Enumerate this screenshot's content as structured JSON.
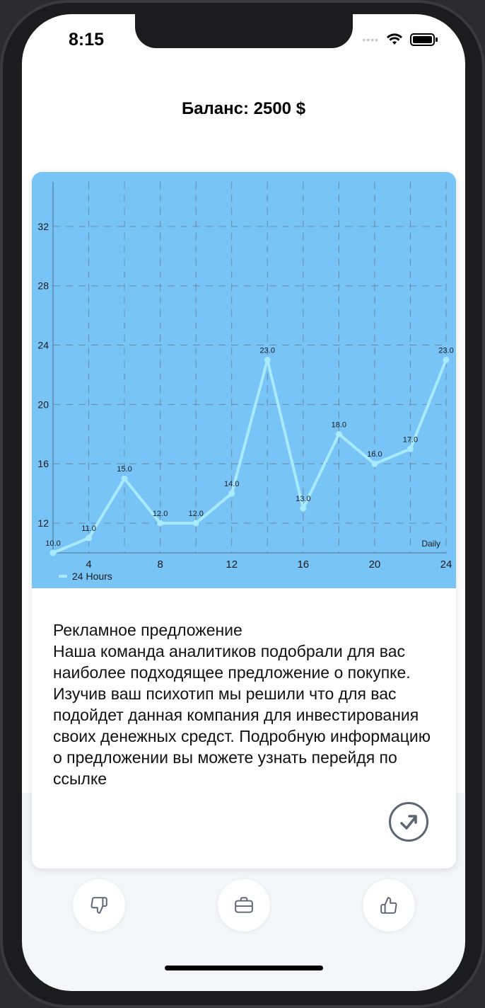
{
  "status_bar": {
    "time": "8:15"
  },
  "header": {
    "balance": "Баланс: 2500 $"
  },
  "chart_data": {
    "type": "line",
    "x": [
      2,
      4,
      6,
      8,
      10,
      12,
      14,
      16,
      18,
      20,
      22,
      24
    ],
    "series": [
      {
        "name": "24 Hours",
        "values": [
          10.0,
          11.0,
          15.0,
          12.0,
          12.0,
          14.0,
          23.0,
          13.0,
          18.0,
          16.0,
          17.0,
          23.0
        ]
      }
    ],
    "point_labels": [
      "10.0",
      "11.0",
      "15.0",
      "12.0",
      "12.0",
      "14.0",
      "23.0",
      "13.0",
      "18.0",
      "16.0",
      "17.0",
      "23.0"
    ],
    "x_ticks": [
      "4",
      "8",
      "12",
      "16",
      "20",
      "24"
    ],
    "y_ticks": [
      "12",
      "16",
      "20",
      "24",
      "28",
      "32"
    ],
    "xlim": [
      2,
      24
    ],
    "ylim": [
      10,
      35
    ],
    "xlabel": "Daily",
    "ylabel": "",
    "grid": true,
    "legend": "bottom-left",
    "colors": {
      "background": "#79c4f6",
      "line": "#a8eaff",
      "grid": "#6a8aa8",
      "text": "#1a1a1a"
    }
  },
  "ad": {
    "title": "Рекламное предложение",
    "body": "Наша команда аналитиков подобрали для вас наиболее подходящее предложение о покупке. Изучив ваш психотип мы решили что для вас подойдет данная компания для инвестирования своих денежных средст. Подробную информацию о предложении вы можете узнать перейдя по ссылке"
  },
  "icons": {
    "open": "arrow-up-right-circle-icon",
    "dislike": "thumbs-down-icon",
    "portfolio": "briefcase-icon",
    "like": "thumbs-up-icon"
  }
}
